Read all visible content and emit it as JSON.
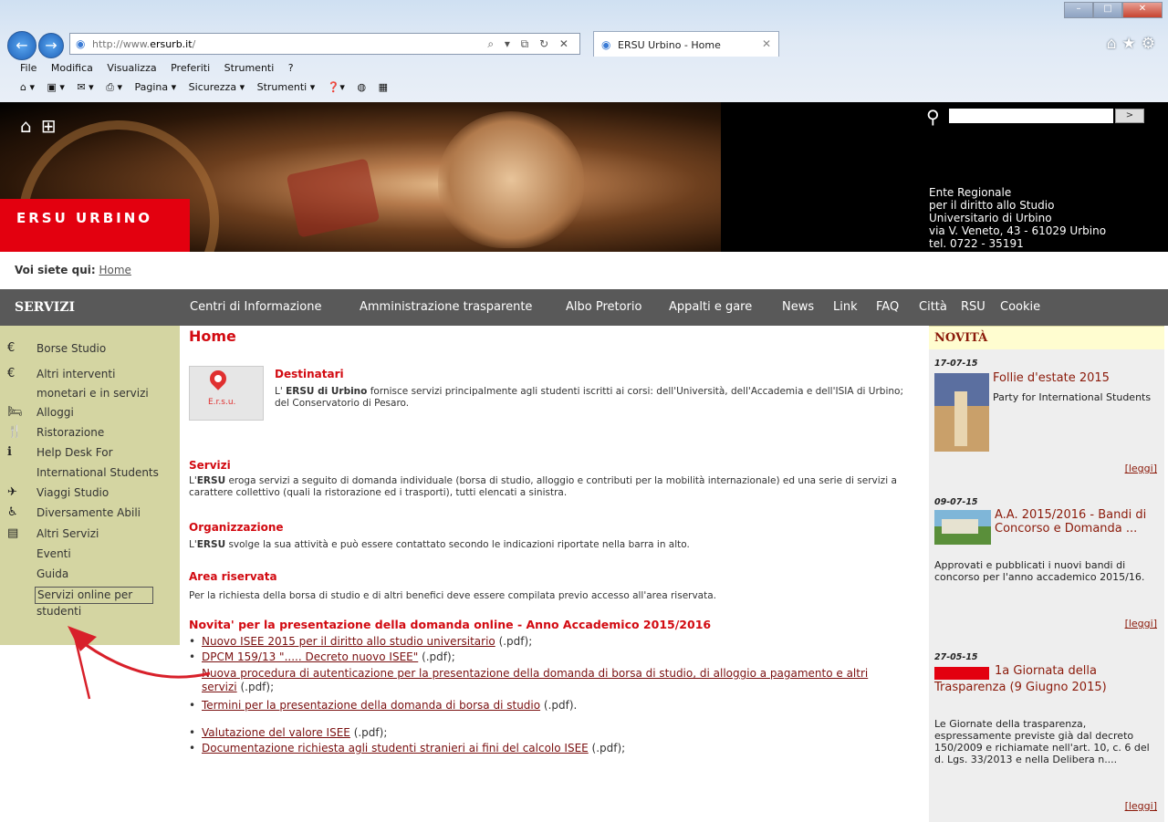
{
  "browser": {
    "url_prefix": "http://www.",
    "url_domain": "ersurb.it",
    "url_suffix": "/",
    "address_controls": "⌕ ▾ ⧉ ↻ ✕",
    "tab_title": "ERSU Urbino - Home",
    "menu": [
      "File",
      "Modifica",
      "Visualizza",
      "Preferiti",
      "Strumenti",
      "?"
    ],
    "commands": [
      "Pagina ▾",
      "Sicurezza ▾",
      "Strumenti ▾"
    ]
  },
  "header": {
    "brand": "ERSU URBINO",
    "info_lines": [
      "Ente Regionale",
      "per il diritto allo Studio",
      "Universitario di Urbino",
      "via V. Veneto, 43 - 61029 Urbino",
      "tel. 0722 - 35191"
    ],
    "search_button": ">"
  },
  "breadcrumb": {
    "label": "Voi siete qui:",
    "link": "Home"
  },
  "sidebar": {
    "title": "SERVIZI",
    "items": [
      {
        "icon": "€",
        "label": "Borse Studio"
      },
      {
        "icon": "€",
        "label": "Altri interventi"
      },
      {
        "icon": "",
        "label": "monetari e in servizi"
      },
      {
        "icon": "🛏",
        "label": "Alloggi"
      },
      {
        "icon": "🍴",
        "label": "Ristorazione"
      },
      {
        "icon": "ℹ",
        "label": "Help Desk For"
      },
      {
        "icon": "",
        "label": "International Students"
      },
      {
        "icon": "✈",
        "label": "Viaggi Studio"
      },
      {
        "icon": "♿",
        "label": "Diversamente Abili"
      },
      {
        "icon": "▤",
        "label": "Altri Servizi"
      },
      {
        "icon": "",
        "label": "Eventi"
      },
      {
        "icon": "",
        "label": "Guida"
      },
      {
        "icon": "",
        "label": "Servizi online per"
      },
      {
        "icon": "",
        "label": "studenti"
      }
    ]
  },
  "topnav": [
    "Centri di Informazione",
    "Amministrazione trasparente",
    "Albo Pretorio",
    "Appalti e gare",
    "News",
    "Link",
    "FAQ",
    "Città",
    "RSU",
    "Cookie"
  ],
  "main": {
    "title": "Home",
    "map_label": "E.r.s.u.",
    "destinatari": {
      "heading": "Destinatari",
      "pre": "L'",
      "bold": "ERSU di Urbino",
      "text": "fornisce servizi principalmente agli studenti iscritti ai corsi: dell'Università, dell'Accademia e dell'ISIA di Urbino; del Conservatorio di Pesaro."
    },
    "servizi": {
      "heading": "Servizi",
      "pre": "L'",
      "bold": "ERSU",
      "text": "eroga servizi a seguito di domanda individuale (borsa di studio, alloggio e contributi per la mobilità internazionale) ed una serie di servizi a carattere collettivo (quali la ristorazione ed i trasporti), tutti elencati a sinistra."
    },
    "organizzazione": {
      "heading": "Organizzazione",
      "pre": "L'",
      "bold": "ERSU",
      "text": "svolge la sua attività e può essere contattato secondo le indicazioni riportate nella barra in alto."
    },
    "area": {
      "heading": "Area riservata",
      "text": "Per la richiesta della borsa di studio e di altri benefici deve essere compilata previo",
      "link": "accesso all'area riservata",
      "after": "."
    },
    "novita_heading": "Novita' per la presentazione della domanda online - Anno Accademico 2015/2016",
    "links": [
      {
        "link": "Nuovo ISEE 2015 per il diritto allo studio universitario",
        "suffix": " (.pdf);"
      },
      {
        "link": "DPCM 159/13 \"..... Decreto nuovo ISEE\"",
        "suffix": " (.pdf);"
      },
      {
        "link": "Nuova procedura di autenticazione per la presentazione della domanda di borsa di studio, di alloggio a pagamento e altri servizi",
        "suffix": " (.pdf);"
      },
      {
        "link": "Termini per la presentazione della domanda di borsa di studio",
        "suffix": " (.pdf)."
      },
      {
        "link": "Valutazione del valore ISEE",
        "suffix": " (.pdf);"
      },
      {
        "link": "Documentazione  richiesta agli studenti stranieri ai fini del calcolo ISEE",
        "suffix": " (.pdf);"
      }
    ]
  },
  "news": {
    "title": "NOVITÀ",
    "read_label": "[leggi]",
    "items": [
      {
        "date": "17-07-15",
        "title": "Follie d'estate 2015",
        "sub": "Party for International Students"
      },
      {
        "date": "09-07-15",
        "title": "A.A. 2015/2016 - Bandi di Concorso e Domanda ...",
        "sub": "Approvati e pubblicati i nuovi bandi di concorso per l'anno accademico 2015/16."
      },
      {
        "date": "27-05-15",
        "title": "1a Giornata della Trasparenza (9 Giugno 2015)",
        "sub": "Le Giornate della trasparenza, espressamente previste già dal decreto 150/2009 e richiamate nell'art. 10, c. 6 del d. Lgs. 33/2013 e nella Delibera n...."
      }
    ]
  },
  "colors": {
    "accent_red": "#d20a11",
    "nav_gray": "#595959",
    "sidebar_bg": "#d4d5a2",
    "news_title": "#8b1a0a"
  }
}
